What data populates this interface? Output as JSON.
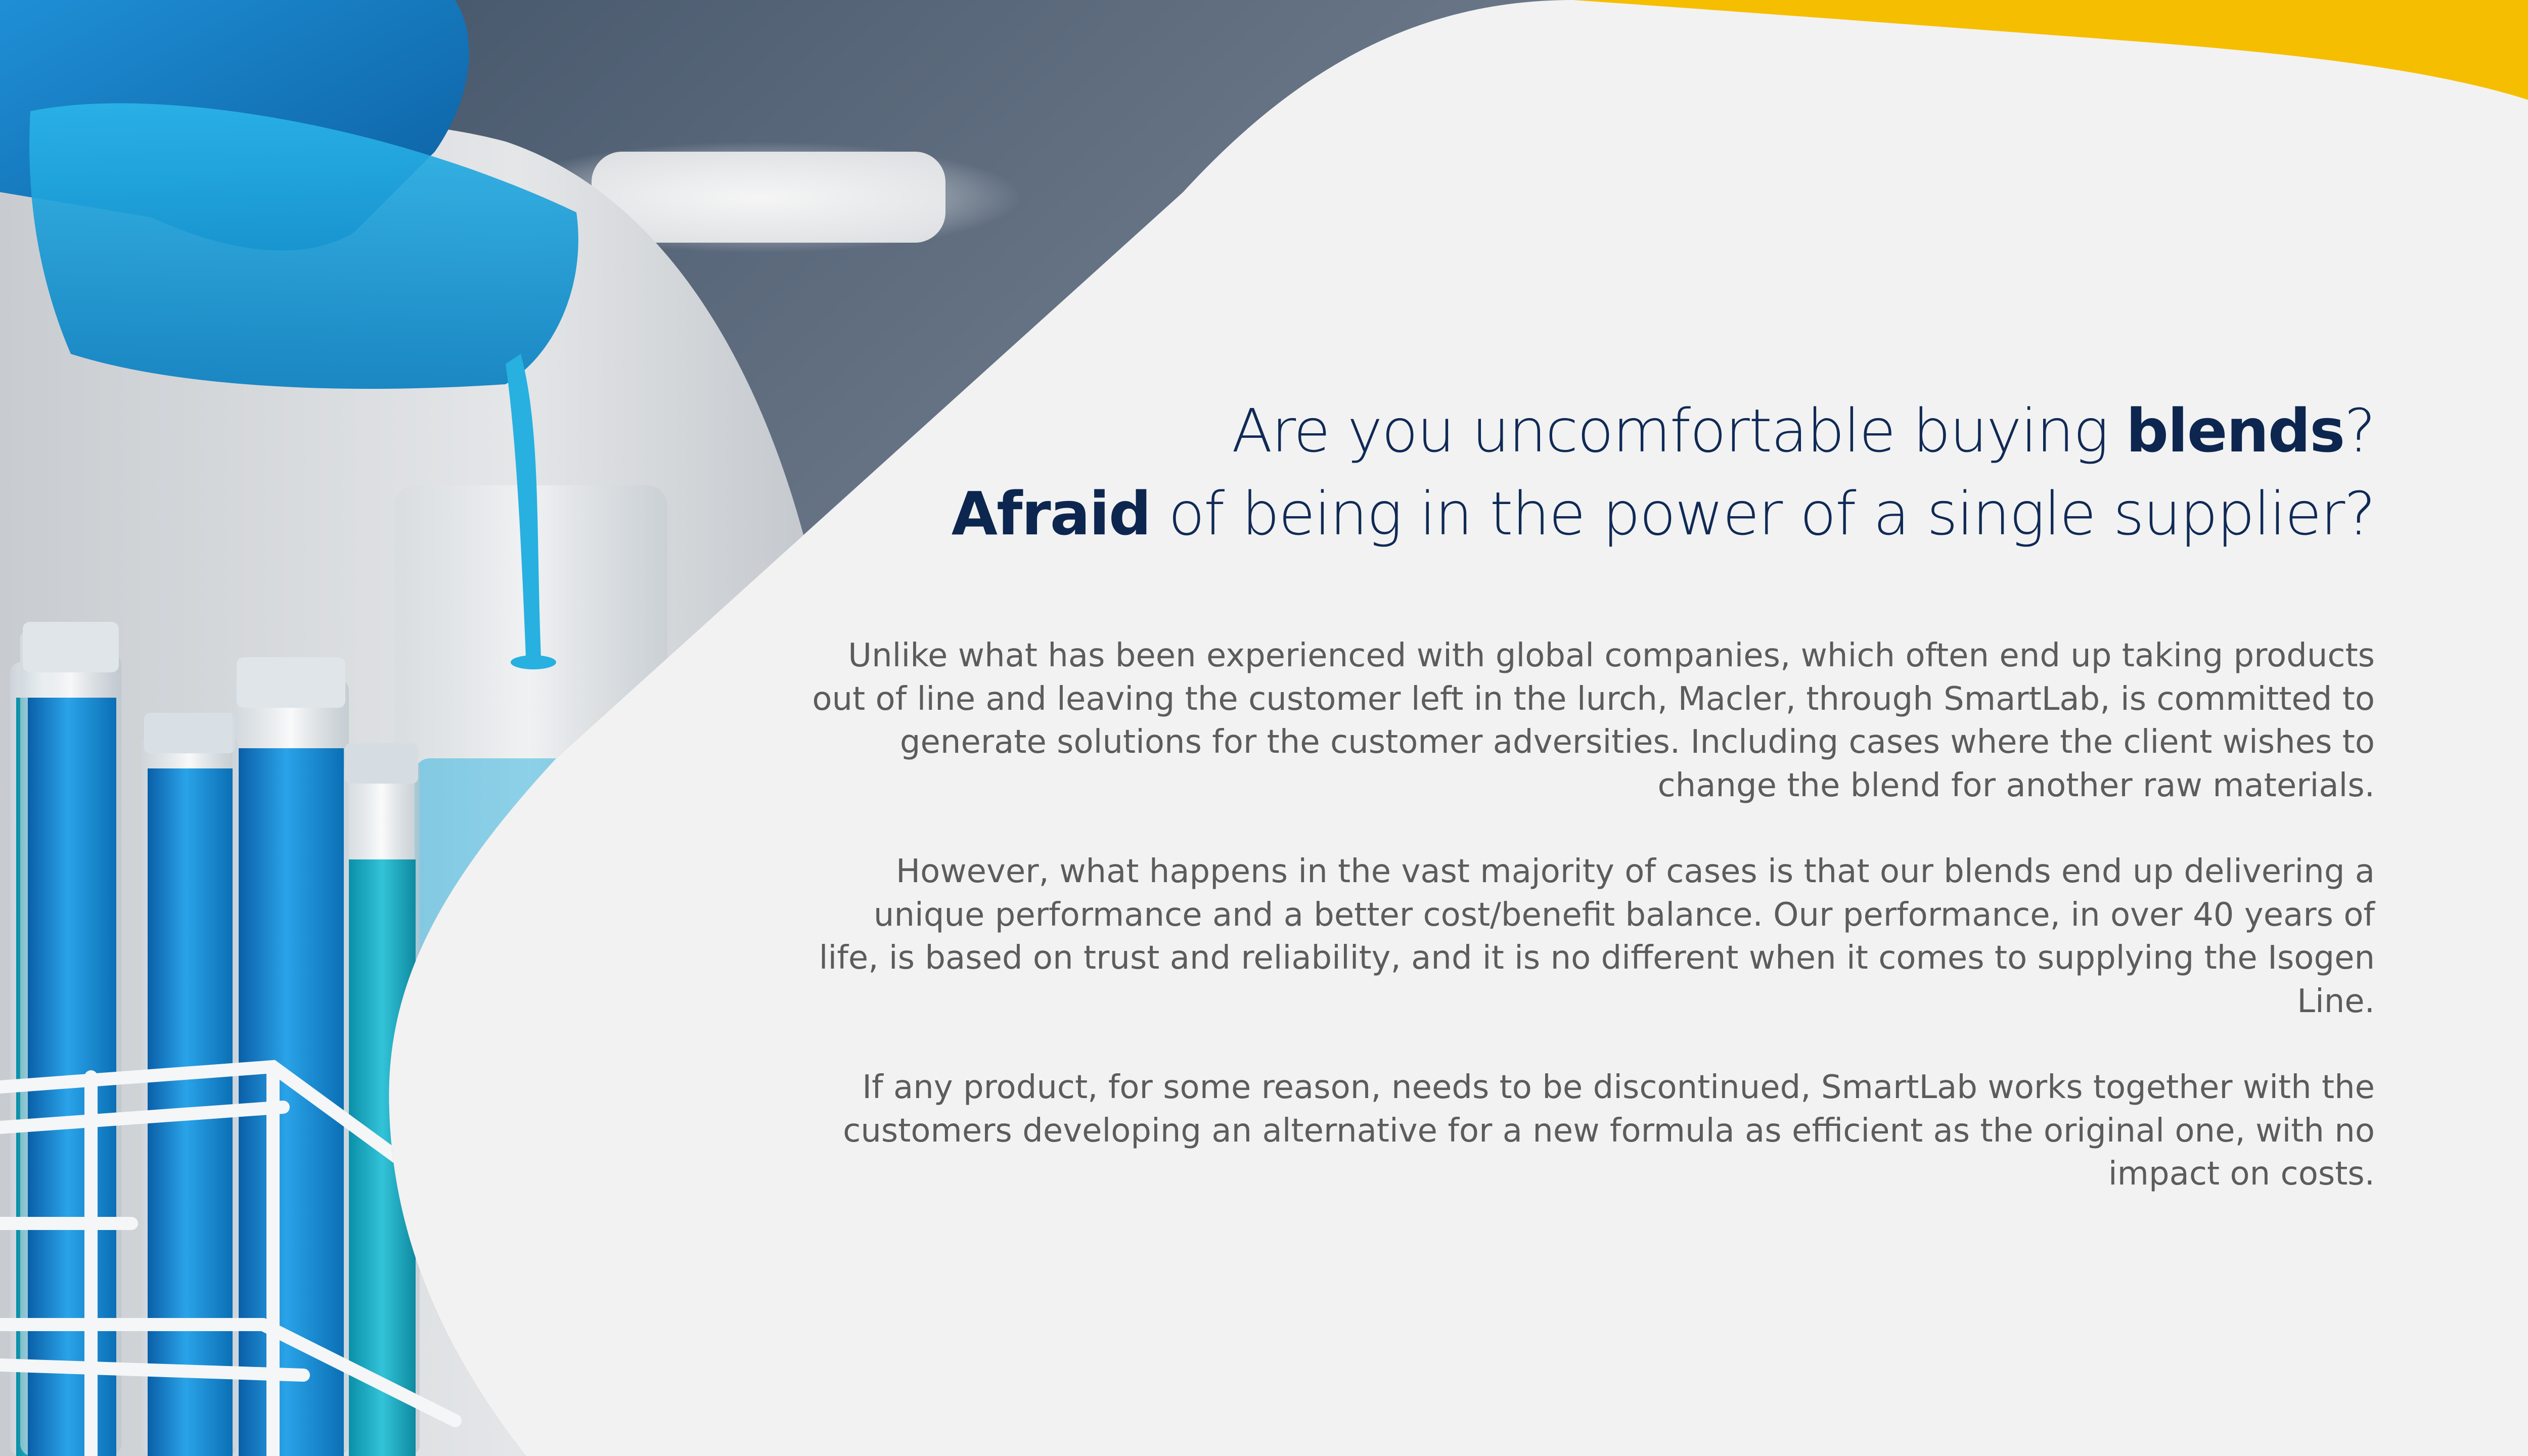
{
  "headline": {
    "line1_pre": "Are you uncomfortable buying ",
    "line1_bold": "blends",
    "line1_post": "?",
    "line2_bold": "Afraid",
    "line2_post": " of being in the power of a single supplier?"
  },
  "body": {
    "paragraphs": [
      "Unlike what has been experienced with global companies, which often end up taking products out of line and leaving the customer left in the lurch, Macler, through SmartLab, is committed to generate solutions for the customer adversities. Including cases where the client wishes to change the blend for another raw materials.",
      "However, what happens in the vast majority of cases is that our blends end up delivering a unique performance and a better cost/benefit balance. Our performance, in over 40 years of life, is based on trust and reliability, and it is no different when it comes to supplying the Isogen Line.",
      "If any product, for some reason, needs to be discontinued, SmartLab works together with the customers developing an alternative for a new formula as efficient as the original one, with no impact on costs."
    ]
  },
  "colors": {
    "background": "#f2f2f2",
    "accent_yellow": "#f6be00",
    "headline_navy": "#0d2650",
    "body_gray": "#5c5c5c"
  }
}
